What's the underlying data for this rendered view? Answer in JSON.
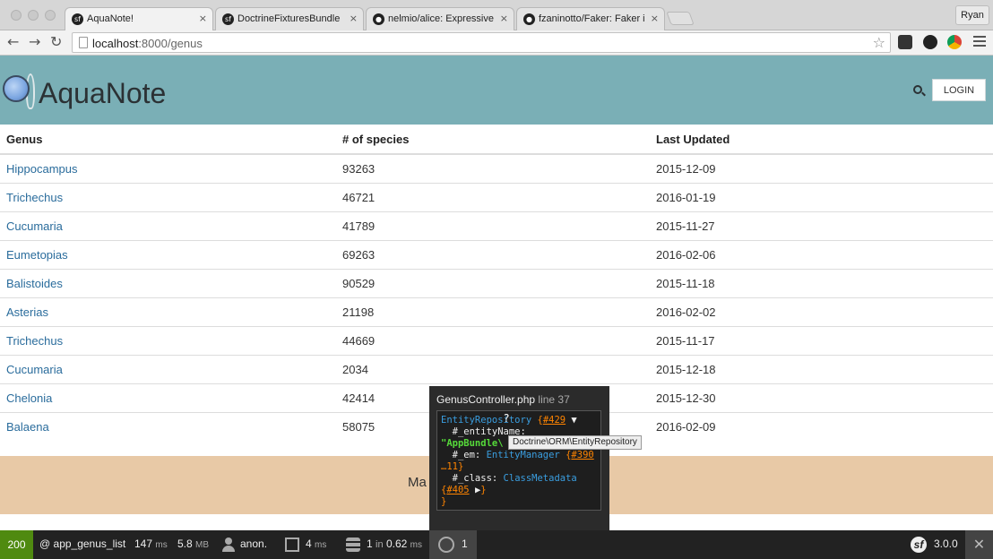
{
  "browser": {
    "tabs": [
      {
        "title": "AquaNote!",
        "icon": "symfony-icon"
      },
      {
        "title": "DoctrineFixturesBundle (Th",
        "icon": "symfony-icon"
      },
      {
        "title": "nelmio/alice: Expressive fix",
        "icon": "github-icon"
      },
      {
        "title": "fzaninotto/Faker: Faker is a",
        "icon": "github-icon"
      }
    ],
    "tab_close": "×",
    "user": "Ryan",
    "url_host": "localhost",
    "url_path": ":8000/genus",
    "star": "☆"
  },
  "header": {
    "brand": "AquaNote",
    "login_label": "LOGIN"
  },
  "table": {
    "columns": [
      "Genus",
      "# of species",
      "Last Updated"
    ],
    "rows": [
      {
        "name": "Hippocampus",
        "species": "93263",
        "updated": "2015-12-09"
      },
      {
        "name": "Trichechus",
        "species": "46721",
        "updated": "2016-01-19"
      },
      {
        "name": "Cucumaria",
        "species": "41789",
        "updated": "2015-11-27"
      },
      {
        "name": "Eumetopias",
        "species": "69263",
        "updated": "2016-02-06"
      },
      {
        "name": "Balistoides",
        "species": "90529",
        "updated": "2015-11-18"
      },
      {
        "name": "Asterias",
        "species": "21198",
        "updated": "2016-02-02"
      },
      {
        "name": "Trichechus",
        "species": "44669",
        "updated": "2015-11-17"
      },
      {
        "name": "Cucumaria",
        "species": "2034",
        "updated": "2015-12-18"
      },
      {
        "name": "Chelonia",
        "species": "42414",
        "updated": "2015-12-30"
      },
      {
        "name": "Balaena",
        "species": "58075",
        "updated": "2016-02-09"
      }
    ]
  },
  "footer": {
    "text": "Ma"
  },
  "dump": {
    "file": "GenusController.php",
    "line": "line 37",
    "tooltip": "Doctrine\\ORM\\EntityRepository"
  },
  "debug": {
    "status": "200",
    "route": "@ app_genus_list",
    "time_value": "147",
    "time_unit": "ms",
    "memory_value": "5.8",
    "memory_unit": "MB",
    "user": "anon.",
    "twig_value": "4",
    "twig_unit": "ms",
    "db_queries": "1",
    "db_in": "in",
    "db_time": "0.62",
    "db_unit": "ms",
    "dump_count": "1",
    "version": "3.0.0",
    "close": "✕"
  },
  "colors": {
    "header_bg": "#7aafb6",
    "link": "#2a6c9c",
    "footer_bg": "#e8c9a6",
    "status_ok": "#4f8a10"
  }
}
